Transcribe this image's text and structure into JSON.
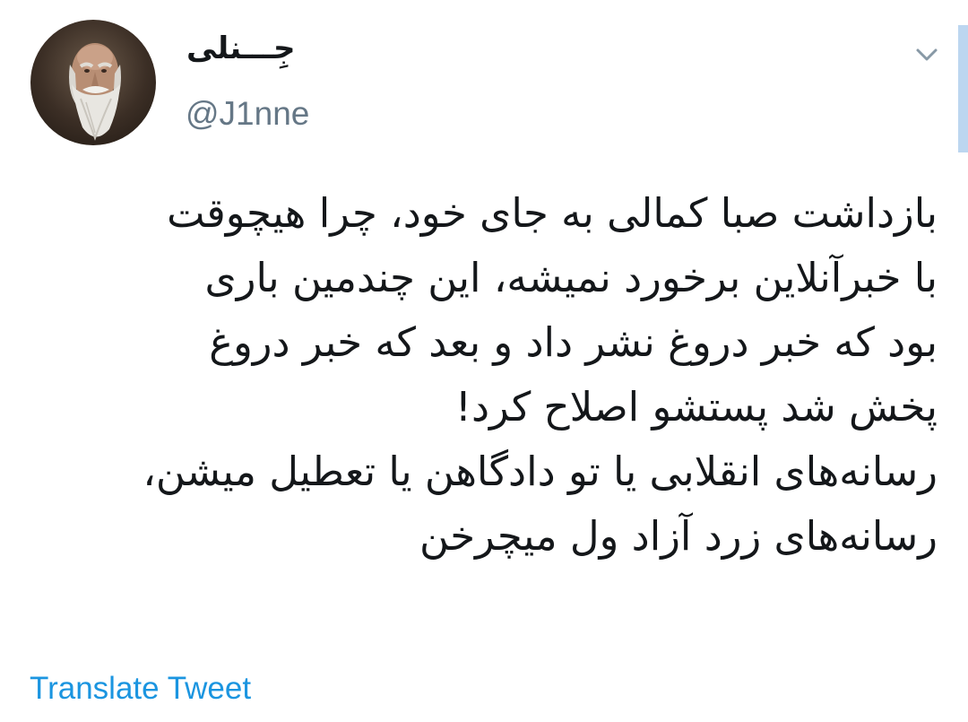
{
  "tweet": {
    "author": {
      "display_name": "جِـــنلی",
      "handle": "@J1nne",
      "avatar_icon": "bearded-old-man-portrait"
    },
    "menu_icon": "chevron-down-icon",
    "text_lines": [
      "بازداشت صبا کمالی به جای خود، چرا هیچوقت",
      "با خبرآنلاین برخورد نمیشه، این چندمین باری",
      "بود که خبر دروغ نشر داد و بعد که خبر دروغ",
      "پخش شد پستشو اصلاح کرد!",
      "رسانه‌های انقلابی یا تو دادگاهن یا تعطیل میشن،",
      "رسانه‌های زرد آزاد ول میچرخن"
    ],
    "translate_label": "Translate Tweet"
  },
  "colors": {
    "text": "#14171a",
    "secondary": "#657786",
    "link": "#1b95e0",
    "scroll_indicator": "#bcd6f0"
  }
}
